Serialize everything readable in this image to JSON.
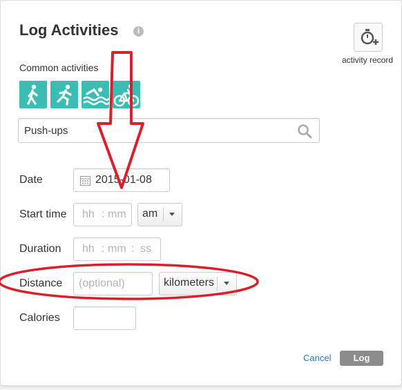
{
  "dialog": {
    "title": "Log Activities",
    "info_icon": "i",
    "activity_record_label": "activity record",
    "activity_record_icon": "stopwatch-plus-icon"
  },
  "common": {
    "label": "Common activities",
    "items": [
      {
        "icon": "walking-icon"
      },
      {
        "icon": "running-icon"
      },
      {
        "icon": "swimming-icon"
      },
      {
        "icon": "cycling-icon"
      }
    ],
    "accent": "#3cbdb4"
  },
  "search": {
    "value": "Push-ups",
    "icon": "search-icon"
  },
  "form": {
    "date": {
      "label": "Date",
      "value": "2015-01-08"
    },
    "start_time": {
      "label": "Start time",
      "hh": "hh",
      "colon": ":",
      "mm": "mm",
      "ampm": "am"
    },
    "duration": {
      "label": "Duration",
      "hh": "hh",
      "colon1": ":",
      "mm": "mm",
      "colon2": ":",
      "ss": "ss"
    },
    "distance": {
      "label": "Distance",
      "placeholder": "(optional)",
      "unit": "kilometers"
    },
    "calories": {
      "label": "Calories",
      "value": ""
    }
  },
  "actions": {
    "cancel": "Cancel",
    "log": "Log"
  },
  "annotations": {
    "color": "#d9202a"
  }
}
